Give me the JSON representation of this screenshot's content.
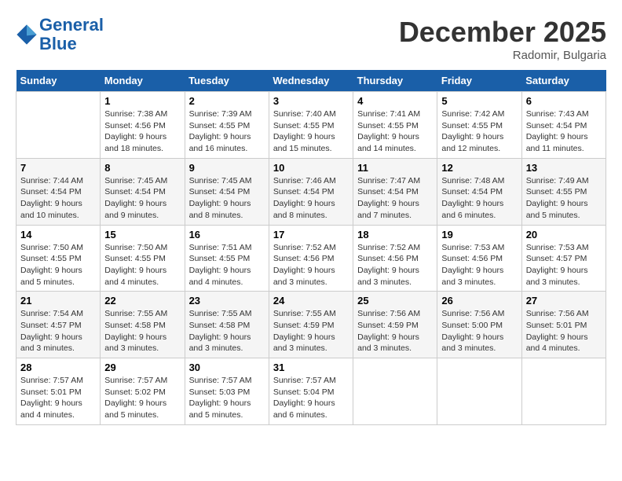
{
  "logo": {
    "line1": "General",
    "line2": "Blue"
  },
  "title": "December 2025",
  "location": "Radomir, Bulgaria",
  "days_of_week": [
    "Sunday",
    "Monday",
    "Tuesday",
    "Wednesday",
    "Thursday",
    "Friday",
    "Saturday"
  ],
  "weeks": [
    [
      {
        "num": "",
        "sunrise": "",
        "sunset": "",
        "daylight": ""
      },
      {
        "num": "1",
        "sunrise": "Sunrise: 7:38 AM",
        "sunset": "Sunset: 4:56 PM",
        "daylight": "Daylight: 9 hours and 18 minutes."
      },
      {
        "num": "2",
        "sunrise": "Sunrise: 7:39 AM",
        "sunset": "Sunset: 4:55 PM",
        "daylight": "Daylight: 9 hours and 16 minutes."
      },
      {
        "num": "3",
        "sunrise": "Sunrise: 7:40 AM",
        "sunset": "Sunset: 4:55 PM",
        "daylight": "Daylight: 9 hours and 15 minutes."
      },
      {
        "num": "4",
        "sunrise": "Sunrise: 7:41 AM",
        "sunset": "Sunset: 4:55 PM",
        "daylight": "Daylight: 9 hours and 14 minutes."
      },
      {
        "num": "5",
        "sunrise": "Sunrise: 7:42 AM",
        "sunset": "Sunset: 4:55 PM",
        "daylight": "Daylight: 9 hours and 12 minutes."
      },
      {
        "num": "6",
        "sunrise": "Sunrise: 7:43 AM",
        "sunset": "Sunset: 4:54 PM",
        "daylight": "Daylight: 9 hours and 11 minutes."
      }
    ],
    [
      {
        "num": "7",
        "sunrise": "Sunrise: 7:44 AM",
        "sunset": "Sunset: 4:54 PM",
        "daylight": "Daylight: 9 hours and 10 minutes."
      },
      {
        "num": "8",
        "sunrise": "Sunrise: 7:45 AM",
        "sunset": "Sunset: 4:54 PM",
        "daylight": "Daylight: 9 hours and 9 minutes."
      },
      {
        "num": "9",
        "sunrise": "Sunrise: 7:45 AM",
        "sunset": "Sunset: 4:54 PM",
        "daylight": "Daylight: 9 hours and 8 minutes."
      },
      {
        "num": "10",
        "sunrise": "Sunrise: 7:46 AM",
        "sunset": "Sunset: 4:54 PM",
        "daylight": "Daylight: 9 hours and 8 minutes."
      },
      {
        "num": "11",
        "sunrise": "Sunrise: 7:47 AM",
        "sunset": "Sunset: 4:54 PM",
        "daylight": "Daylight: 9 hours and 7 minutes."
      },
      {
        "num": "12",
        "sunrise": "Sunrise: 7:48 AM",
        "sunset": "Sunset: 4:54 PM",
        "daylight": "Daylight: 9 hours and 6 minutes."
      },
      {
        "num": "13",
        "sunrise": "Sunrise: 7:49 AM",
        "sunset": "Sunset: 4:55 PM",
        "daylight": "Daylight: 9 hours and 5 minutes."
      }
    ],
    [
      {
        "num": "14",
        "sunrise": "Sunrise: 7:50 AM",
        "sunset": "Sunset: 4:55 PM",
        "daylight": "Daylight: 9 hours and 5 minutes."
      },
      {
        "num": "15",
        "sunrise": "Sunrise: 7:50 AM",
        "sunset": "Sunset: 4:55 PM",
        "daylight": "Daylight: 9 hours and 4 minutes."
      },
      {
        "num": "16",
        "sunrise": "Sunrise: 7:51 AM",
        "sunset": "Sunset: 4:55 PM",
        "daylight": "Daylight: 9 hours and 4 minutes."
      },
      {
        "num": "17",
        "sunrise": "Sunrise: 7:52 AM",
        "sunset": "Sunset: 4:56 PM",
        "daylight": "Daylight: 9 hours and 3 minutes."
      },
      {
        "num": "18",
        "sunrise": "Sunrise: 7:52 AM",
        "sunset": "Sunset: 4:56 PM",
        "daylight": "Daylight: 9 hours and 3 minutes."
      },
      {
        "num": "19",
        "sunrise": "Sunrise: 7:53 AM",
        "sunset": "Sunset: 4:56 PM",
        "daylight": "Daylight: 9 hours and 3 minutes."
      },
      {
        "num": "20",
        "sunrise": "Sunrise: 7:53 AM",
        "sunset": "Sunset: 4:57 PM",
        "daylight": "Daylight: 9 hours and 3 minutes."
      }
    ],
    [
      {
        "num": "21",
        "sunrise": "Sunrise: 7:54 AM",
        "sunset": "Sunset: 4:57 PM",
        "daylight": "Daylight: 9 hours and 3 minutes."
      },
      {
        "num": "22",
        "sunrise": "Sunrise: 7:55 AM",
        "sunset": "Sunset: 4:58 PM",
        "daylight": "Daylight: 9 hours and 3 minutes."
      },
      {
        "num": "23",
        "sunrise": "Sunrise: 7:55 AM",
        "sunset": "Sunset: 4:58 PM",
        "daylight": "Daylight: 9 hours and 3 minutes."
      },
      {
        "num": "24",
        "sunrise": "Sunrise: 7:55 AM",
        "sunset": "Sunset: 4:59 PM",
        "daylight": "Daylight: 9 hours and 3 minutes."
      },
      {
        "num": "25",
        "sunrise": "Sunrise: 7:56 AM",
        "sunset": "Sunset: 4:59 PM",
        "daylight": "Daylight: 9 hours and 3 minutes."
      },
      {
        "num": "26",
        "sunrise": "Sunrise: 7:56 AM",
        "sunset": "Sunset: 5:00 PM",
        "daylight": "Daylight: 9 hours and 3 minutes."
      },
      {
        "num": "27",
        "sunrise": "Sunrise: 7:56 AM",
        "sunset": "Sunset: 5:01 PM",
        "daylight": "Daylight: 9 hours and 4 minutes."
      }
    ],
    [
      {
        "num": "28",
        "sunrise": "Sunrise: 7:57 AM",
        "sunset": "Sunset: 5:01 PM",
        "daylight": "Daylight: 9 hours and 4 minutes."
      },
      {
        "num": "29",
        "sunrise": "Sunrise: 7:57 AM",
        "sunset": "Sunset: 5:02 PM",
        "daylight": "Daylight: 9 hours and 5 minutes."
      },
      {
        "num": "30",
        "sunrise": "Sunrise: 7:57 AM",
        "sunset": "Sunset: 5:03 PM",
        "daylight": "Daylight: 9 hours and 5 minutes."
      },
      {
        "num": "31",
        "sunrise": "Sunrise: 7:57 AM",
        "sunset": "Sunset: 5:04 PM",
        "daylight": "Daylight: 9 hours and 6 minutes."
      },
      {
        "num": "",
        "sunrise": "",
        "sunset": "",
        "daylight": ""
      },
      {
        "num": "",
        "sunrise": "",
        "sunset": "",
        "daylight": ""
      },
      {
        "num": "",
        "sunrise": "",
        "sunset": "",
        "daylight": ""
      }
    ]
  ]
}
